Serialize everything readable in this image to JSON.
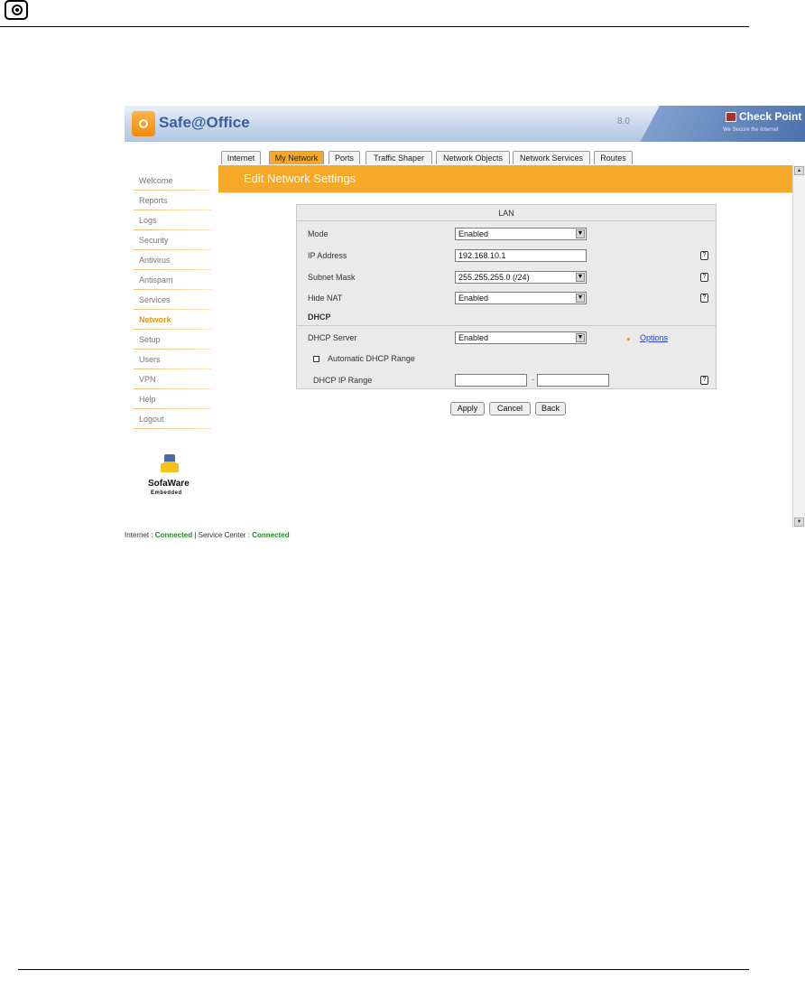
{
  "header": {
    "app_title": "Safe@Office",
    "version": "8.0",
    "brand_name": "Check Point",
    "brand_tagline": "We Secure the Internet"
  },
  "tabs": [
    {
      "label": "Internet"
    },
    {
      "label": "My Network",
      "active": true
    },
    {
      "label": "Ports"
    },
    {
      "label": "Traffic Shaper"
    },
    {
      "label": "Network Objects"
    },
    {
      "label": "Network Services"
    },
    {
      "label": "Routes"
    }
  ],
  "sidebar": {
    "items": [
      {
        "label": "Welcome"
      },
      {
        "label": "Reports"
      },
      {
        "label": "Logs"
      },
      {
        "label": "Security"
      },
      {
        "label": "Antivirus"
      },
      {
        "label": "Antispam"
      },
      {
        "label": "Services"
      },
      {
        "label": "Network",
        "active": true
      },
      {
        "label": "Setup"
      },
      {
        "label": "Users"
      },
      {
        "label": "VPN"
      },
      {
        "label": "Help"
      },
      {
        "label": "Logout"
      }
    ],
    "logo_name": "SofaWare",
    "logo_sub": "Embedded"
  },
  "page": {
    "heading": "Edit Network Settings"
  },
  "form": {
    "lan_title": "LAN",
    "mode_label": "Mode",
    "mode_value": "Enabled",
    "ip_label": "IP Address",
    "ip_value": "192.168.10.1",
    "subnet_label": "Subnet Mask",
    "subnet_value": "255.255.255.0 (/24)",
    "hide_nat_label": "Hide NAT",
    "hide_nat_value": "Enabled",
    "dhcp_title": "DHCP",
    "dhcp_server_label": "DHCP Server",
    "dhcp_server_value": "Enabled",
    "options_link": "Options",
    "auto_range_label": "Automatic DHCP Range",
    "auto_range_checked": false,
    "dhcp_range_label": "DHCP IP Range",
    "dhcp_range_from": "",
    "dhcp_range_to": "",
    "range_separator": "-",
    "help_glyph": "?"
  },
  "buttons": {
    "apply": "Apply",
    "cancel": "Cancel",
    "back": "Back"
  },
  "status": {
    "internet_label": "Internet : ",
    "internet_value": "Connected",
    "service_label": " | Service Center : ",
    "service_value": "Connected"
  }
}
